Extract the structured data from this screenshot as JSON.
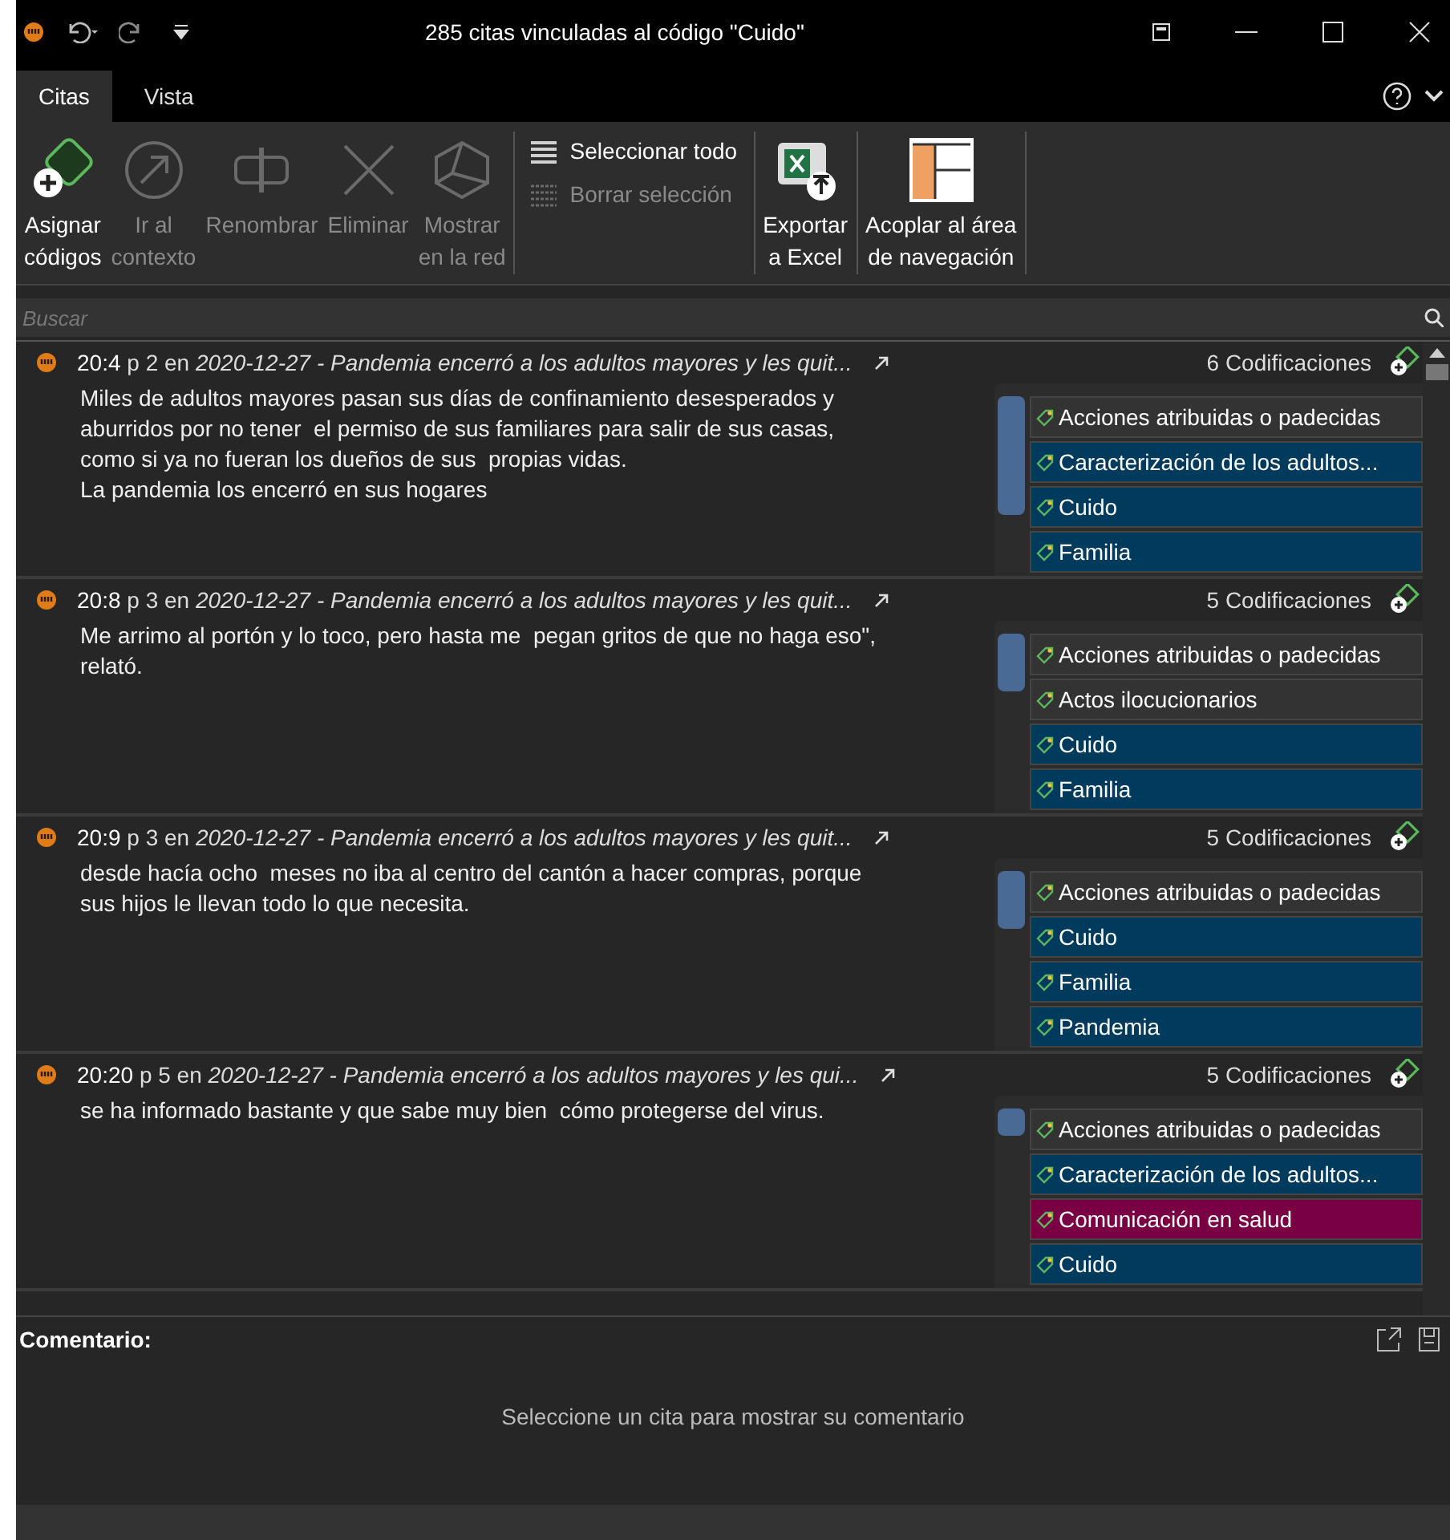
{
  "window": {
    "title": "285 citas vinculadas al código \"Cuido\""
  },
  "tabs": [
    {
      "label": "Citas",
      "selected": true
    },
    {
      "label": "Vista",
      "selected": false
    }
  ],
  "ribbon": {
    "groups": [
      {
        "kind": "big",
        "buttons": [
          {
            "label": [
              "Asignar",
              "códigos"
            ],
            "disabled": false
          },
          {
            "label": [
              "Ir al",
              "contexto"
            ],
            "disabled": true
          },
          {
            "label": [
              "Renombrar"
            ],
            "disabled": true
          },
          {
            "label": [
              "Eliminar"
            ],
            "disabled": true
          },
          {
            "label": [
              "Mostrar",
              "en la red"
            ],
            "disabled": true
          }
        ]
      },
      {
        "kind": "small",
        "buttons": [
          {
            "label": [
              "Seleccionar todo"
            ],
            "disabled": false
          },
          {
            "label": [
              "Borrar selección"
            ],
            "disabled": true
          }
        ]
      },
      {
        "kind": "big",
        "buttons": [
          {
            "label": [
              "Exportar",
              "a Excel"
            ],
            "disabled": false
          }
        ]
      },
      {
        "kind": "big",
        "buttons": [
          {
            "label": [
              "Acoplar al área",
              "de navegación"
            ],
            "disabled": false
          }
        ]
      }
    ]
  },
  "search": {
    "placeholder": "Buscar"
  },
  "quotes": [
    {
      "id": "20:4",
      "page": "p 2",
      "prep": "en",
      "document": "2020-12-27 - Pandemia encerró a los adultos mayores y les quit...",
      "count": "6 Codificaciones",
      "body": [
        "Miles de adultos mayores pasan sus días de confinamiento desesperados y",
        "aburridos por no tener  el permiso de sus familiares para salir de sus casas,",
        "como si ya no fueran los dueños de sus  propias vidas.",
        "La pandemia los encerró en sus hogares"
      ],
      "codes": [
        {
          "label": "Acciones atribuidas o padecidas",
          "color": "#333333"
        },
        {
          "label": "Caracterización de los adultos...",
          "color": "#003a5c"
        },
        {
          "label": "Cuido",
          "color": "#003a5c"
        },
        {
          "label": "Familia",
          "color": "#003a5c"
        }
      ]
    },
    {
      "id": "20:8",
      "page": "p 3",
      "prep": "en",
      "document": "2020-12-27 - Pandemia encerró a los adultos mayores y les quit...",
      "count": "5 Codificaciones",
      "body": [
        "Me arrimo al portón y lo toco, pero hasta me  pegan gritos de que no haga eso\",",
        "relató."
      ],
      "codes": [
        {
          "label": "Acciones atribuidas o padecidas",
          "color": "#333333"
        },
        {
          "label": "Actos ilocucionarios",
          "color": "#333333"
        },
        {
          "label": "Cuido",
          "color": "#003a5c"
        },
        {
          "label": "Familia",
          "color": "#003a5c"
        }
      ]
    },
    {
      "id": "20:9",
      "page": "p 3",
      "prep": "en",
      "document": "2020-12-27 - Pandemia encerró a los adultos mayores y les quit...",
      "count": "5 Codificaciones",
      "body": [
        "desde hacía ocho  meses no iba al centro del cantón a hacer compras, porque",
        "sus hijos le llevan todo lo que necesita."
      ],
      "codes": [
        {
          "label": "Acciones atribuidas o padecidas",
          "color": "#333333"
        },
        {
          "label": "Cuido",
          "color": "#003a5c"
        },
        {
          "label": "Familia",
          "color": "#003a5c"
        },
        {
          "label": "Pandemia",
          "color": "#003a5c"
        }
      ]
    },
    {
      "id": "20:20",
      "page": "p 5",
      "prep": "en",
      "document": "2020-12-27 - Pandemia encerró a los adultos mayores y les qui...",
      "count": "5 Codificaciones",
      "body": [
        "se ha informado bastante y que sabe muy bien  cómo protegerse del virus."
      ],
      "codes": [
        {
          "label": "Acciones atribuidas o padecidas",
          "color": "#333333"
        },
        {
          "label": "Caracterización de los adultos...",
          "color": "#003a5c"
        },
        {
          "label": "Comunicación en salud",
          "color": "#7a0044"
        },
        {
          "label": "Cuido",
          "color": "#003a5c"
        }
      ]
    }
  ],
  "comment": {
    "label": "Comentario:",
    "empty_message": "Seleccione un cita para mostrar su comentario"
  }
}
